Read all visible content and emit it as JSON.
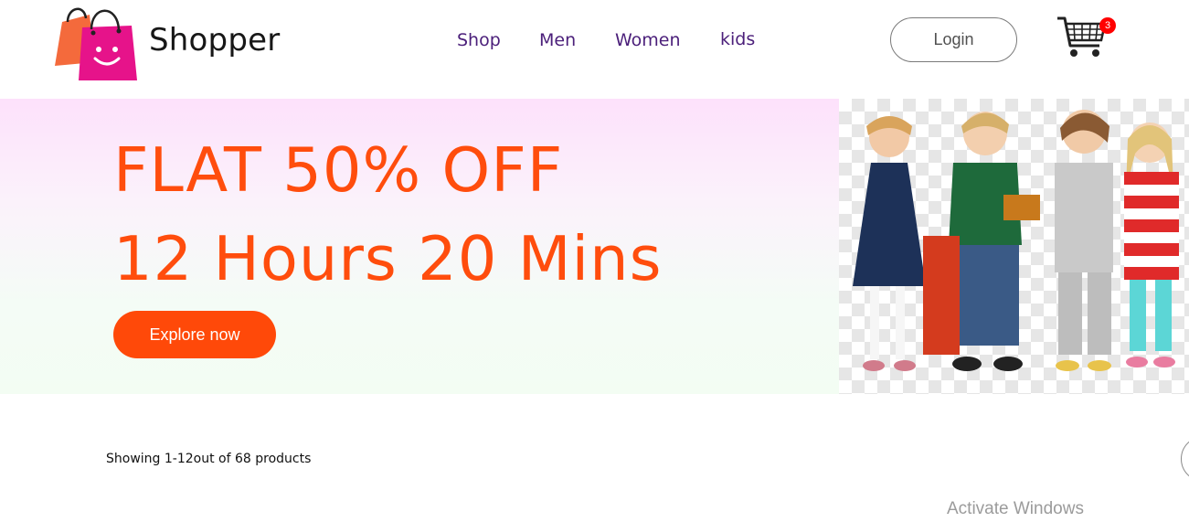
{
  "nav": {
    "brand": "Shopper",
    "menu": [
      {
        "label": "Shop"
      },
      {
        "label": "Men"
      },
      {
        "label": "Women"
      },
      {
        "label": "kids"
      }
    ],
    "login_label": "Login",
    "cart_count": "3",
    "logo_icon": "shopping-bags-logo",
    "cart_icon": "shopping-cart-icon"
  },
  "hero": {
    "line1": "FLAT 50% OFF",
    "line2": "12 Hours 20 Mins",
    "cta_label": "Explore now",
    "image": "four-kids-photo"
  },
  "listing": {
    "showing_text": "Showing 1-12out of 68 products"
  },
  "os_watermark": "Activate Windows",
  "colors": {
    "accent": "#ff4909",
    "nav_link": "#4b1f7a",
    "badge": "#ff0000",
    "logo_pink": "#e6138a",
    "logo_orange": "#f46a3c"
  }
}
